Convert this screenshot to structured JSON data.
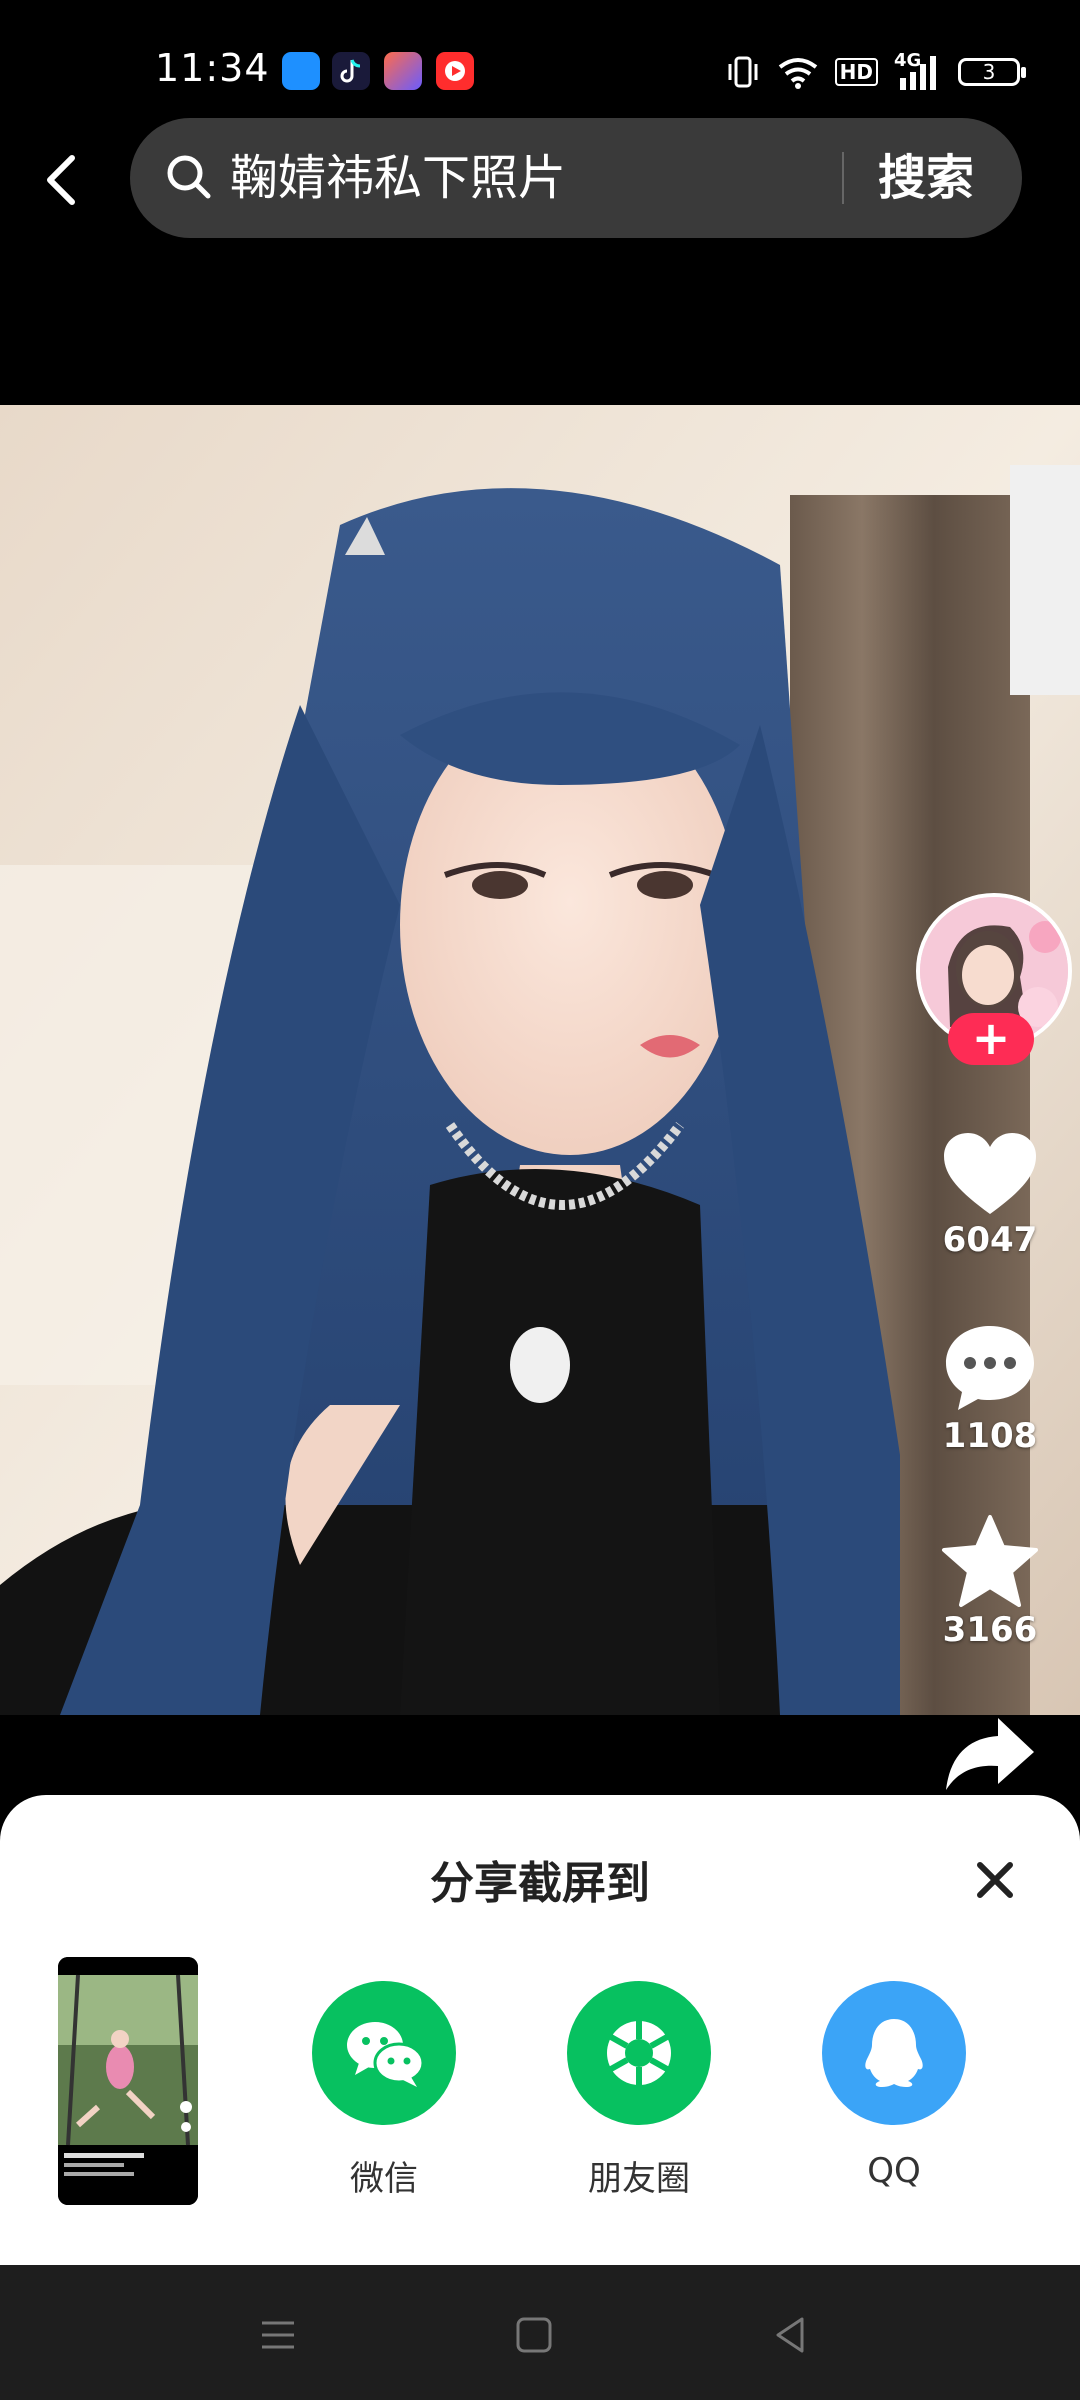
{
  "status_bar": {
    "time": "11:34",
    "hd_label": "HD",
    "network_label": "4G",
    "battery_level": "3",
    "app_icons": [
      "blue-app-icon",
      "tiktok-lite-icon",
      "shortcut-app-icon",
      "video-app-icon"
    ]
  },
  "search": {
    "query": "鞠婧祎私下照片",
    "button_label": "搜索"
  },
  "actions": {
    "likes": "6047",
    "comments": "1108",
    "favorites": "3166"
  },
  "share_sheet": {
    "title": "分享截屏到",
    "options": [
      {
        "label": "微信",
        "icon": "wechat-icon",
        "color": "#07c160"
      },
      {
        "label": "朋友圈",
        "icon": "moments-icon",
        "color": "#07c160"
      },
      {
        "label": "QQ",
        "icon": "qq-icon",
        "color": "#3ba4f7"
      }
    ]
  },
  "colors": {
    "accent": "#fe2c55",
    "sheet_bg": "#ffffff",
    "search_bg": "#3a3a3a"
  }
}
